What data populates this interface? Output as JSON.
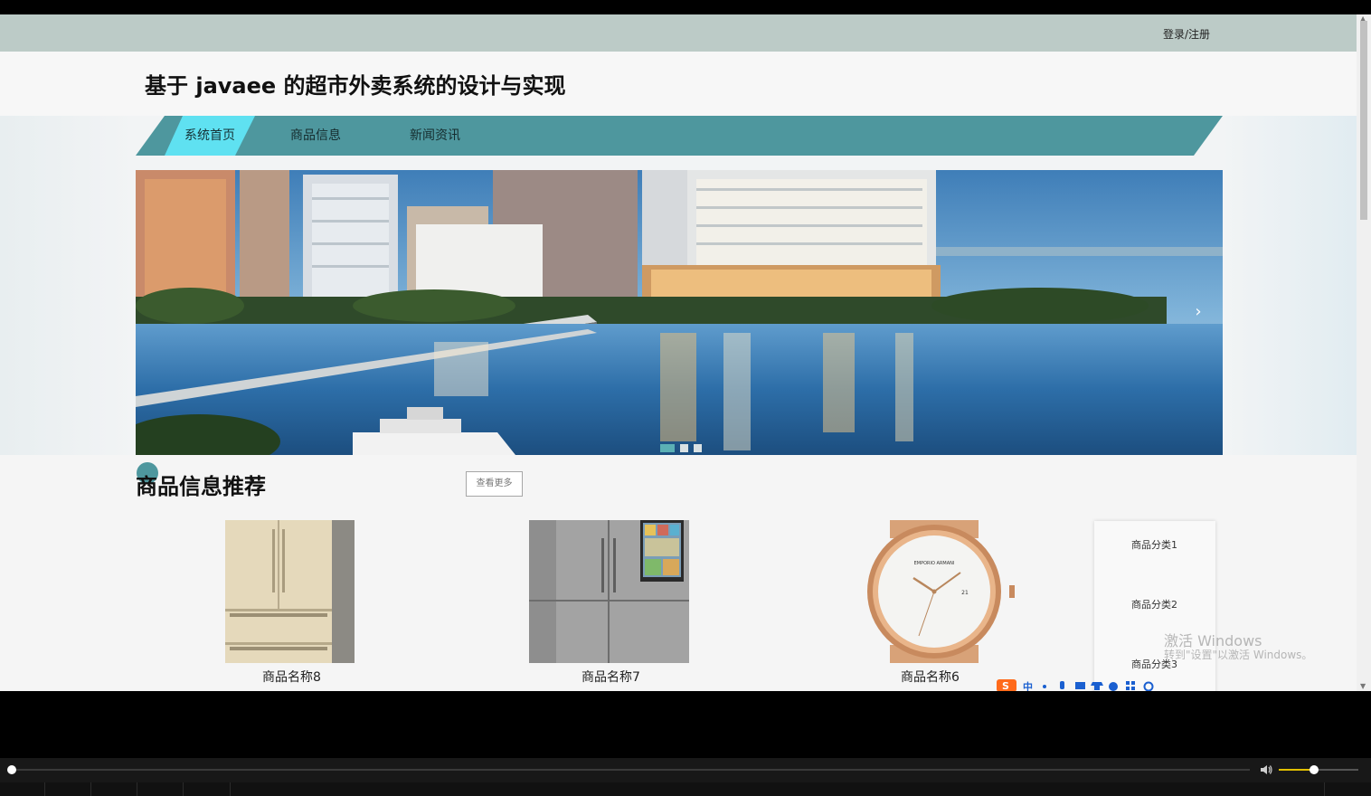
{
  "header": {
    "login_link": "登录/注册",
    "site_title": "基于 javaee 的超市外卖系统的设计与实现"
  },
  "nav": {
    "items": [
      {
        "label": "系统首页",
        "active": true
      },
      {
        "label": "商品信息",
        "active": false
      },
      {
        "label": "新闻资讯",
        "active": false
      }
    ]
  },
  "banner": {
    "next_icon": "›",
    "slide_count": 3,
    "active_slide": 1
  },
  "section": {
    "title": "商品信息推荐",
    "more_button": "查看更多"
  },
  "products": [
    {
      "name": "商品名称8",
      "image": "fridge-french-door"
    },
    {
      "name": "商品名称7",
      "image": "fridge-side-by-side"
    },
    {
      "name": "商品名称6",
      "image": "wristwatch"
    }
  ],
  "watch_brand": "EMPORIO ARMANI",
  "watch_date": "21",
  "categories": [
    "商品分类1",
    "商品分类2",
    "商品分类3"
  ],
  "watermark": {
    "line1": "激活 Windows",
    "line2": "转到\"设置\"以激活 Windows。"
  },
  "ime_bar": {
    "lang": "中",
    "icons": [
      "sogou-logo-icon",
      "punctuation-icon",
      "microphone-icon",
      "keyboard-icon",
      "shirt-icon",
      "emoji-icon",
      "toolbox-icon",
      "settings-icon"
    ]
  },
  "player": {
    "progress": 0.0,
    "volume": 0.4
  },
  "colors": {
    "topbar": "#bccbc7",
    "nav": "#4e979e",
    "nav_active": "#5fe1f1",
    "volume_accent": "#e2c000"
  }
}
